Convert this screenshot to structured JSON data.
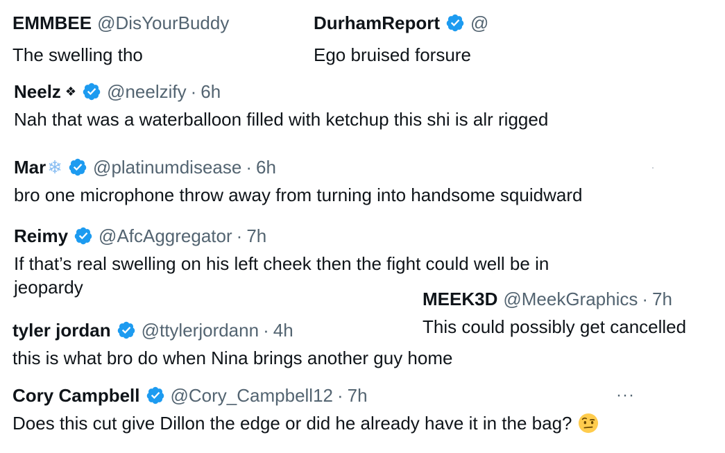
{
  "tweets": [
    {
      "name": "EMMBEE",
      "handle": "@DisYourBuddy",
      "time": "",
      "text": "The swelling tho"
    },
    {
      "name": "DurhamReport",
      "handle": "@",
      "time": "",
      "text": "Ego bruised forsure"
    },
    {
      "name": "Neelz",
      "handle": "@neelzify",
      "time": "6h",
      "text": "Nah that was a waterballoon filled with ketchup this shi is alr rigged"
    },
    {
      "name": "Mar",
      "handle": "@platinumdisease",
      "time": "6h",
      "text": "bro one microphone throw away from turning into handsome squidward"
    },
    {
      "name": "Reimy",
      "handle": "@AfcAggregator",
      "time": "7h",
      "text_line1": "If that’s real swelling on his left cheek then the fight could well be in",
      "text_line2": "jeopardy"
    },
    {
      "name": "MEEK3D",
      "handle": "@MeekGraphics",
      "time": "7h",
      "text": "This could possibly get cancelled"
    },
    {
      "name": "tyler jordan",
      "handle": "@ttylerjordann",
      "time": "4h",
      "text": "this is what bro do when Nina brings another guy home"
    },
    {
      "name": "Cory Campbell",
      "handle": "@Cory_Campbell12",
      "time": "7h",
      "text": "Does this cut give Dillon the edge or did he already have it in the bag?"
    }
  ],
  "separator": "·",
  "icons": {
    "verified": "verified-badge-icon",
    "diamond": "❖",
    "snowflake": "❄",
    "more": "···",
    "emoji": "face-with-raised-eyebrow-emoji"
  },
  "colors": {
    "name": "#0f1419",
    "muted": "#536471",
    "verified": "#1d9bf0",
    "background": "#ffffff"
  }
}
